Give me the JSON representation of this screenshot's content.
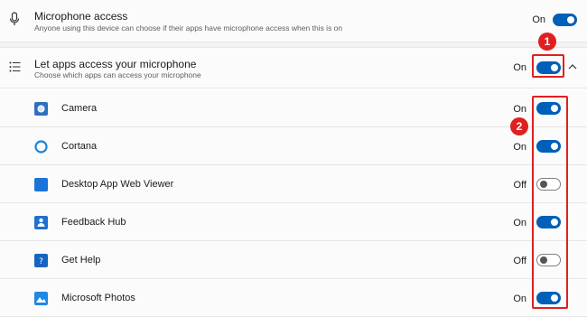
{
  "microphone_access": {
    "title": "Microphone access",
    "description": "Anyone using this device can choose if their apps have microphone access when this is on",
    "state": "On",
    "toggle_on": true
  },
  "let_apps": {
    "title": "Let apps access your microphone",
    "description": "Choose which apps can access your microphone",
    "state": "On",
    "toggle_on": true,
    "expanded": true
  },
  "apps": [
    {
      "name": "Camera",
      "state": "On",
      "icon": "camera-app-icon",
      "color": "#2f6fbf"
    },
    {
      "name": "Cortana",
      "state": "On",
      "icon": "cortana-app-icon",
      "color": "#1a86d8"
    },
    {
      "name": "Desktop App Web Viewer",
      "state": "Off",
      "icon": "web-viewer-app-icon",
      "color": "#1a73d9"
    },
    {
      "name": "Feedback Hub",
      "state": "On",
      "icon": "feedback-hub-app-icon",
      "color": "#1f6fd0"
    },
    {
      "name": "Get Help",
      "state": "Off",
      "icon": "get-help-app-icon",
      "color": "#1565c0"
    },
    {
      "name": "Microsoft Photos",
      "state": "On",
      "icon": "photos-app-icon",
      "color": "#1e88e5"
    }
  ],
  "callouts": {
    "one": "1",
    "two": "2",
    "color": "#e02020"
  },
  "colors": {
    "accent": "#005fb8",
    "background": "#fbfbfb"
  }
}
